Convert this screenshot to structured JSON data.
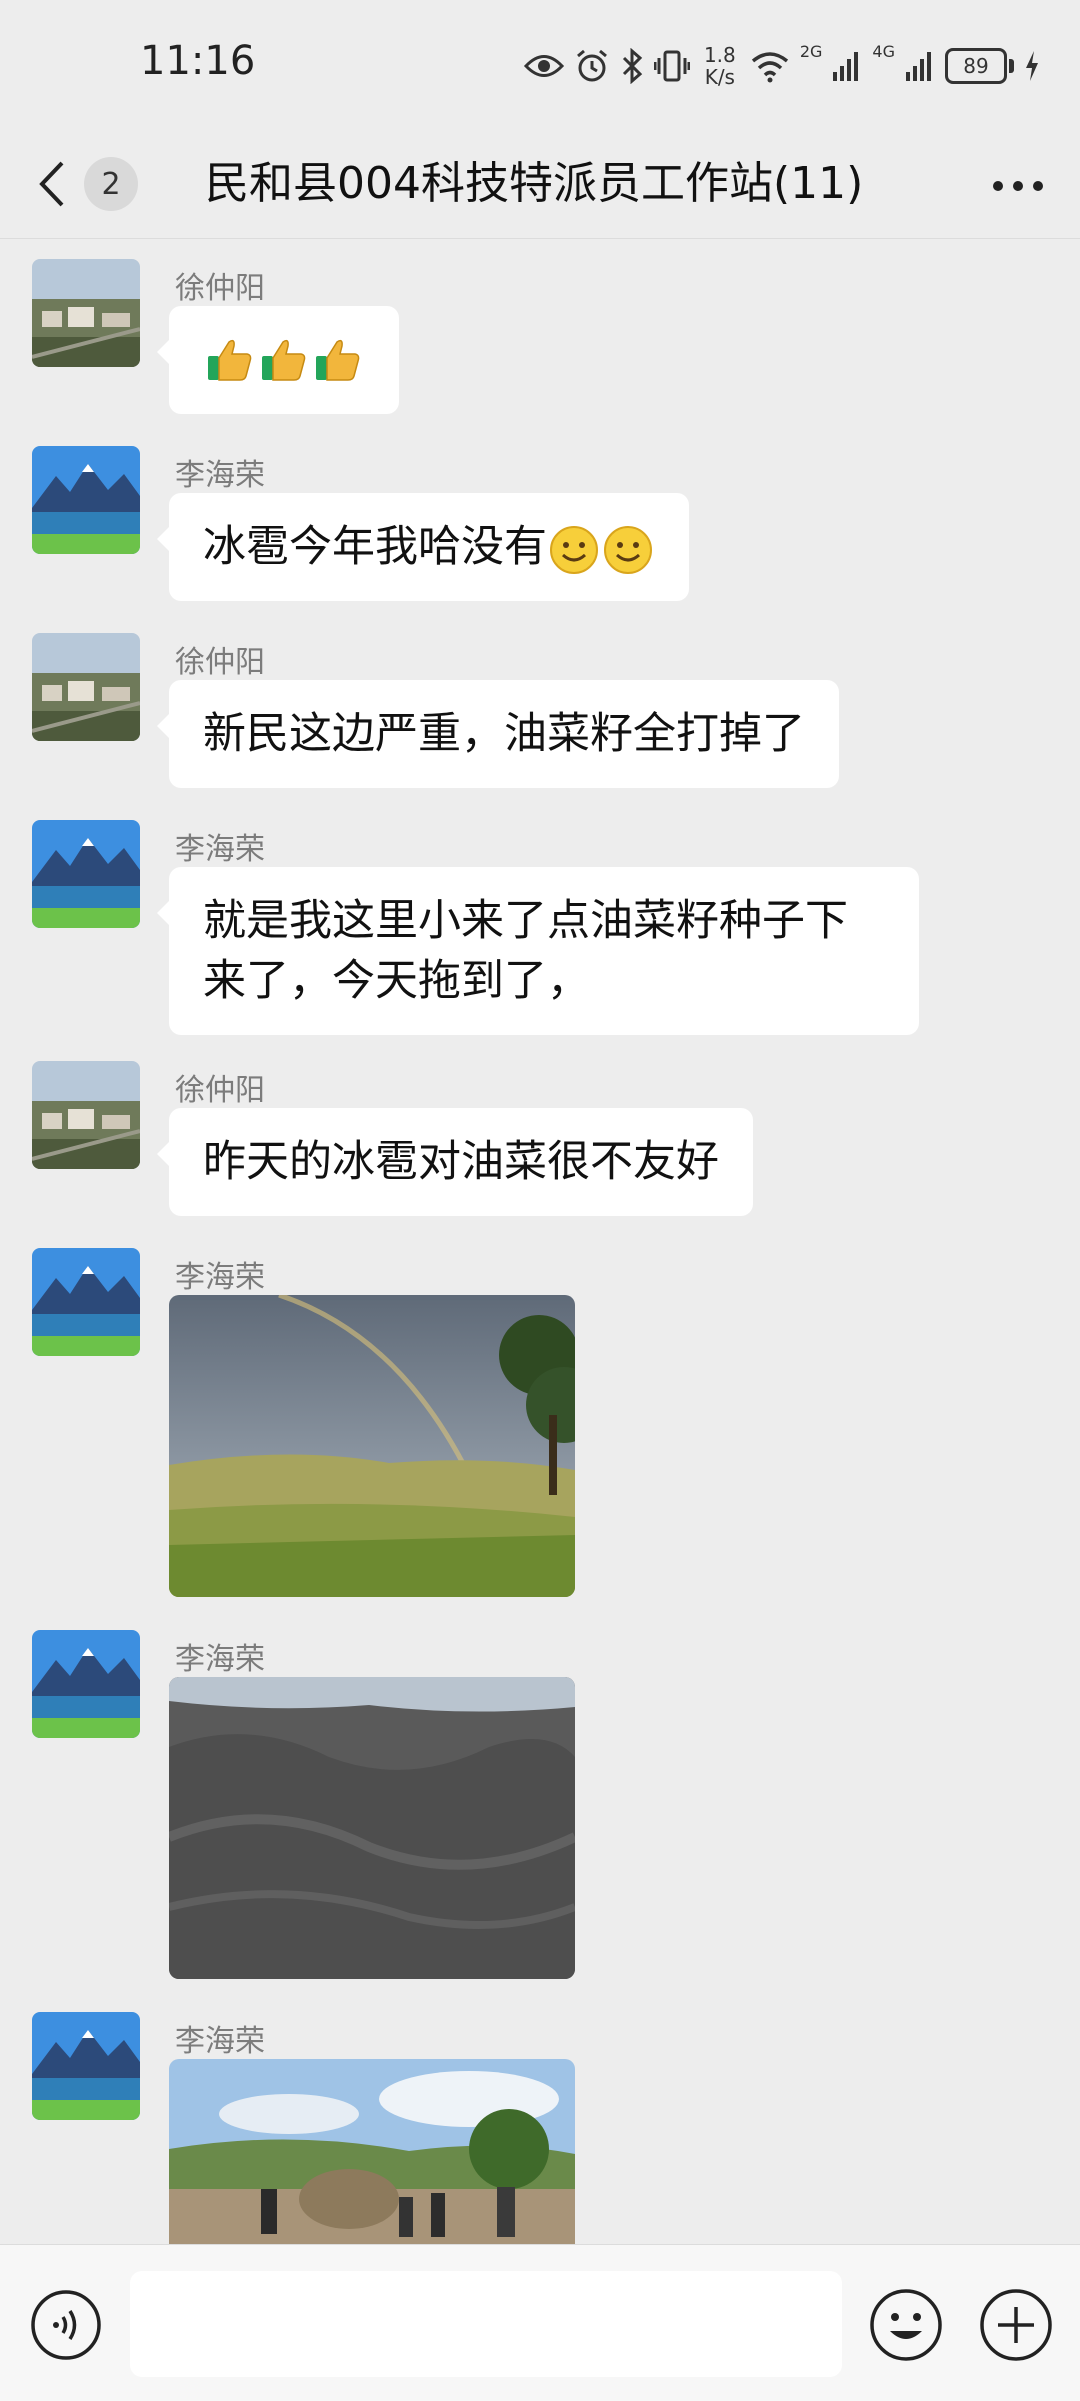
{
  "status_bar": {
    "time": "11:16",
    "net_speed_value": "1.8",
    "net_speed_unit": "K/s",
    "network_1": "2G",
    "network_2": "4G",
    "battery": "89"
  },
  "header": {
    "unread_count": "2",
    "title": "民和县004科技特派员工作站(11)"
  },
  "messages": [
    {
      "sender": "徐仲阳",
      "type": "emoji",
      "emoji": "thumbs-up",
      "count": 3
    },
    {
      "sender": "李海荣",
      "type": "text",
      "text": "冰雹今年我哈没有",
      "emoji": "smile",
      "count": 2
    },
    {
      "sender": "徐仲阳",
      "type": "text",
      "text": "新民这边严重，油菜籽全打掉了"
    },
    {
      "sender": "李海荣",
      "type": "text",
      "line1": "就是我这里小来了点油菜籽种子下",
      "line2": "来了，今天拖到了，"
    },
    {
      "sender": "徐仲阳",
      "type": "text",
      "text": "昨天的冰雹对油菜很不友好"
    },
    {
      "sender": "李海荣",
      "type": "image",
      "image": "rainbow-field-photo"
    },
    {
      "sender": "李海荣",
      "type": "image",
      "image": "rapeseed-pile-photo"
    },
    {
      "sender": "李海荣",
      "type": "image",
      "image": "threshing-workers-photo"
    }
  ],
  "colors": {
    "background": "#ededed",
    "bubble": "#ffffff",
    "sender_name": "#7c7c7c"
  }
}
